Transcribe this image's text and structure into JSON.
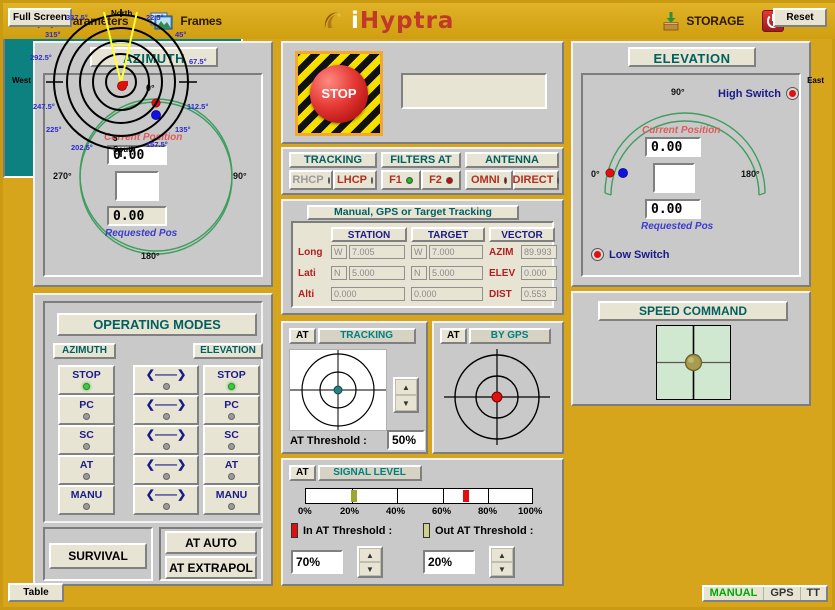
{
  "header": {
    "left_items": [
      {
        "label": "Parameters",
        "icon": "wrench-screwdriver-icon"
      },
      {
        "label": "Frames",
        "icon": "frames-image-icon"
      }
    ],
    "logo": {
      "text_i": "i",
      "text_rest": "Hyptra",
      "icon": "crescent-moon-icon"
    },
    "right_items": [
      {
        "label": "STORAGE",
        "icon": "storage-download-icon"
      },
      {
        "label": "EXIT",
        "icon": "power-icon"
      }
    ]
  },
  "azimuth": {
    "title": "AZIMUTH",
    "current_label": "Current Position",
    "current_value": "0.00",
    "middle_value": "",
    "requested_value": "0.00",
    "requested_label": "Requested Pos",
    "ticks": {
      "top": "0°",
      "right": "90°",
      "bottom": "180°",
      "left": "270°"
    }
  },
  "elevation": {
    "title": "ELEVATION",
    "current_label": "Current Position",
    "current_value": "0.00",
    "middle_value": "",
    "requested_value": "0.00",
    "requested_label": "Requested Pos",
    "ticks": {
      "top": "90°",
      "left": "0°",
      "right": "180°"
    },
    "high_switch": "High Switch",
    "low_switch": "Low Switch",
    "high_switch_led": "#e01010",
    "low_switch_led": "#e01010"
  },
  "stop": {
    "label": "STOP",
    "display_value": ""
  },
  "tracking_bar": {
    "groups": [
      {
        "title": "TRACKING",
        "buttons": [
          {
            "label": "RHCP",
            "led": "green",
            "dim": true
          },
          {
            "label": "LHCP",
            "led": "red",
            "dim": false
          }
        ]
      },
      {
        "title": "FILTERS AT",
        "buttons": [
          {
            "label": "F1",
            "led": "green",
            "dim": false
          },
          {
            "label": "F2",
            "led": "red",
            "dim": false
          }
        ]
      },
      {
        "title": "ANTENNA",
        "buttons": [
          {
            "label": "OMNI",
            "led": "red",
            "dim": false
          },
          {
            "label": "DIRECT",
            "led": "red",
            "dim": false
          }
        ]
      }
    ]
  },
  "manual_gps": {
    "title": "Manual, GPS or Target Tracking",
    "col_station": "STATION",
    "col_target": "TARGET",
    "col_vector": "VECTOR",
    "rows": [
      {
        "label": "Long",
        "station_hemi": "W",
        "station_val": "7.005",
        "target_hemi": "W",
        "target_val": "7.000"
      },
      {
        "label": "Lati",
        "station_hemi": "N",
        "station_val": "5.000",
        "target_hemi": "N",
        "target_val": "5.000"
      },
      {
        "label": "Alti",
        "station_hemi": "",
        "station_val": "0.000",
        "target_hemi": "",
        "target_val": "0.000"
      }
    ],
    "vector": [
      {
        "label": "AZIM",
        "value": "89.993"
      },
      {
        "label": "ELEV",
        "value": "0.000"
      },
      {
        "label": "DIST",
        "value": "0.553"
      }
    ]
  },
  "at_tracking": {
    "at_label": "AT",
    "title": "TRACKING",
    "threshold_label": "AT Threshold :",
    "threshold_value": "50%",
    "spin_up": "▲",
    "spin_down": "▼",
    "dot_color": "#2a7f7f"
  },
  "at_gps": {
    "at_label": "AT",
    "title": "BY  GPS",
    "dot_color": "#e01010"
  },
  "signal_level": {
    "at_label": "AT",
    "title": "SIGNAL LEVEL",
    "scale": [
      "0%",
      "20%",
      "40%",
      "60%",
      "80%",
      "100%"
    ],
    "marker_out_pct": 21,
    "marker_in_pct": 70,
    "marker_out_color": "#9aa82e",
    "marker_in_color": "#e01010",
    "in_label": "In AT Threshold :",
    "out_label": "Out AT Threshold :",
    "in_value": "70%",
    "out_value": "20%",
    "spin_up": "▲",
    "spin_down": "▼"
  },
  "operating_modes": {
    "title": "OPERATING MODES",
    "azimuth_label": "AZIMUTH",
    "elevation_label": "ELEVATION",
    "rows": [
      {
        "az": "STOP",
        "az_on": true,
        "arrow": "❮——❯",
        "el": "STOP",
        "el_on": true
      },
      {
        "az": "PC",
        "az_on": false,
        "arrow": "❮——❯",
        "el": "PC",
        "el_on": false
      },
      {
        "az": "SC",
        "az_on": false,
        "arrow": "❮——❯",
        "el": "SC",
        "el_on": false
      },
      {
        "az": "AT",
        "az_on": false,
        "arrow": "❮——❯",
        "el": "AT",
        "el_on": false
      },
      {
        "az": "MANU",
        "az_on": false,
        "arrow": "❮——❯",
        "el": "MANU",
        "el_on": false
      }
    ],
    "survival": "SURVIVAL",
    "at_auto": "AT AUTO",
    "at_extrapol": "AT EXTRAPOL"
  },
  "speed_command": {
    "title": "SPEED COMMAND",
    "knob_color": "#a89a4e"
  },
  "radar": {
    "full_screen": "Full Screen",
    "reset": "Reset",
    "table": "Table",
    "modes": [
      {
        "label": "MANUAL",
        "active": true
      },
      {
        "label": "GPS",
        "active": false
      },
      {
        "label": "TT",
        "active": false
      }
    ],
    "cardinals": {
      "north": "North",
      "east": "East",
      "south": "South",
      "west": "West"
    },
    "angles": [
      "22.5°",
      "45°",
      "67.5°",
      "112.5°",
      "135°",
      "157.5°",
      "202.5°",
      "225°",
      "247.5°",
      "292.5°",
      "315°",
      "337.5°"
    ],
    "ring_count": "5",
    "target_color": "#e01010",
    "beam_color": "#ffff33",
    "bg_color": "#0d8080"
  }
}
